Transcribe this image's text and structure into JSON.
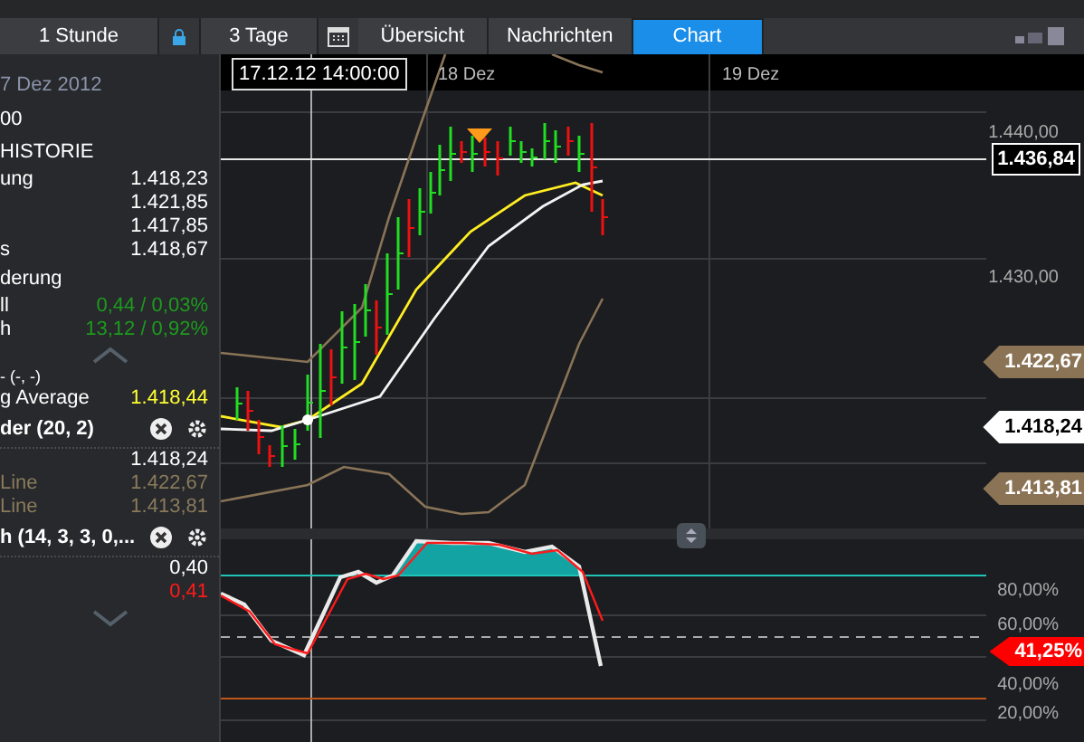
{
  "toolbar": {
    "period": "1 Stunde",
    "range": "3 Tage"
  },
  "tabs": [
    {
      "label": "Übersicht",
      "selected": false
    },
    {
      "label": "Nachrichten",
      "selected": false
    },
    {
      "label": "Chart",
      "selected": true
    }
  ],
  "side_panel": {
    "rows": [
      {
        "kind": "date",
        "label": "7 Dez 2012"
      },
      {
        "kind": "header",
        "label": "00"
      },
      {
        "kind": "header",
        "label": "HISTORIE"
      },
      {
        "kind": "value",
        "label": "ung",
        "value": "1.418,23",
        "color": "#ffffff"
      },
      {
        "kind": "value",
        "value": "1.421,85",
        "color": "#ffffff"
      },
      {
        "kind": "value",
        "value": "1.417,85",
        "color": "#ffffff"
      },
      {
        "kind": "value",
        "label": "s",
        "value": "1.418,67",
        "color": "#ffffff"
      },
      {
        "kind": "header",
        "label": "derung"
      },
      {
        "kind": "value",
        "label": "ll",
        "value": "0,44 / 0,03%",
        "color": "#1e9a1e"
      },
      {
        "kind": "value",
        "label": "h",
        "value": "13,12 / 0,92%",
        "color": "#1e9a1e"
      },
      {
        "kind": "scroll_up"
      },
      {
        "kind": "cut",
        "label": "- (-, -)"
      },
      {
        "kind": "value",
        "label": "g Average",
        "value": "1.418,44",
        "color": "#ffff33"
      },
      {
        "kind": "indicator",
        "label": "der (20, 2)"
      },
      {
        "kind": "value",
        "value": "1.418,24",
        "color": "#ffffff"
      },
      {
        "kind": "value",
        "label": "Line",
        "value": "1.422,67",
        "color": "#8a7a5c"
      },
      {
        "kind": "value",
        "label": "Line",
        "value": "1.413,81",
        "color": "#8a7a5c"
      },
      {
        "kind": "indicator",
        "label": "h (14, 3, 3, 0,..."
      },
      {
        "kind": "value",
        "value": "0,40",
        "color": "#ffffff"
      },
      {
        "kind": "value",
        "value": "0,41",
        "color": "#ff1a1a"
      },
      {
        "kind": "scroll_down"
      }
    ]
  },
  "chart": {
    "crosshair_time": "17.12.12 14:00:00",
    "date_labels": [
      "18 Dez",
      "19 Dez"
    ],
    "price_ticks": [
      "1.440,00",
      "1.430,00"
    ],
    "price_tags": [
      {
        "kind": "current",
        "value": "1.436,84"
      },
      {
        "kind": "band",
        "value": "1.422,67"
      },
      {
        "kind": "middle",
        "value": "1.418,24"
      },
      {
        "kind": "band",
        "value": "1.413,81"
      }
    ]
  },
  "oscillator": {
    "ticks": [
      "80,00%",
      "60,00%",
      "40,00%",
      "20,00%"
    ],
    "tag": "41,25%"
  }
}
